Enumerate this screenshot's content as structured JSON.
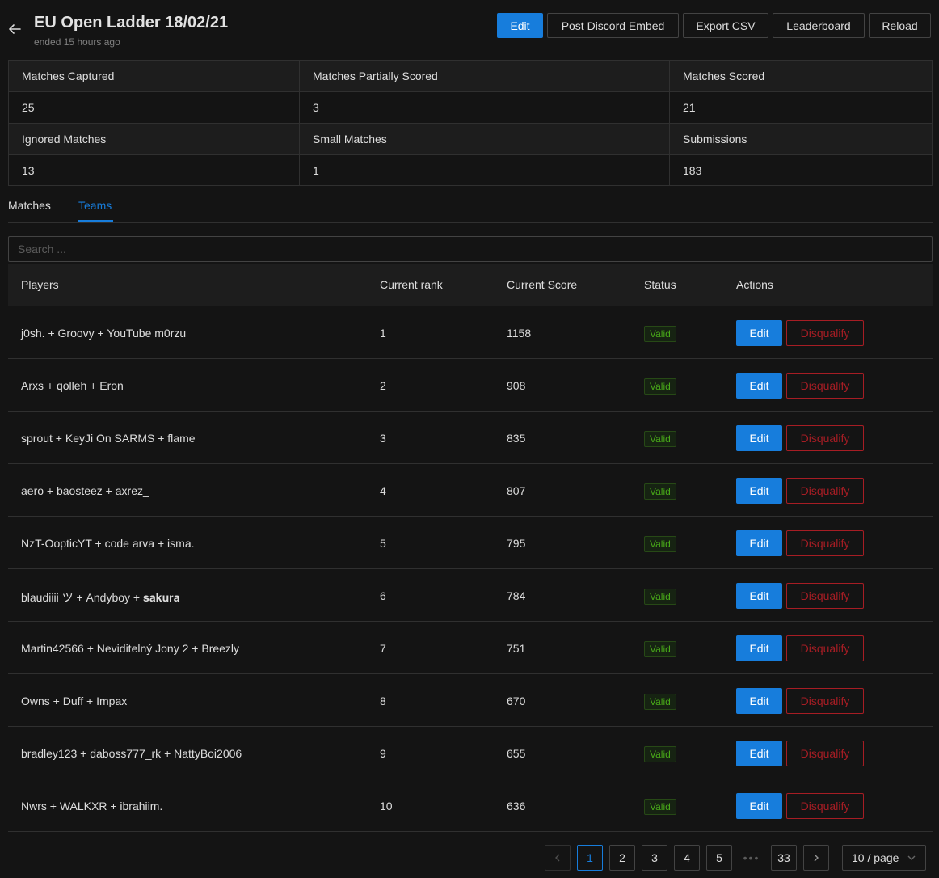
{
  "header": {
    "title": "EU Open Ladder 18/02/21",
    "subtitle": "ended 15 hours ago",
    "buttons": {
      "edit": "Edit",
      "post_discord_embed": "Post Discord Embed",
      "export_csv": "Export CSV",
      "leaderboard": "Leaderboard",
      "reload": "Reload"
    },
    "back_icon": "arrow-left-icon"
  },
  "stats": {
    "matches_captured": {
      "label": "Matches Captured",
      "value": "25"
    },
    "matches_partially_scored": {
      "label": "Matches Partially Scored",
      "value": "3"
    },
    "matches_scored": {
      "label": "Matches Scored",
      "value": "21"
    },
    "ignored_matches": {
      "label": "Ignored Matches",
      "value": "13"
    },
    "small_matches": {
      "label": "Small Matches",
      "value": "1"
    },
    "submissions": {
      "label": "Submissions",
      "value": "183"
    }
  },
  "tabs": [
    {
      "label": "Matches",
      "active": false
    },
    {
      "label": "Teams",
      "active": true
    }
  ],
  "search": {
    "placeholder": "Search ..."
  },
  "table": {
    "columns": {
      "players": "Players",
      "rank": "Current rank",
      "score": "Current Score",
      "status": "Status",
      "actions": "Actions"
    },
    "action_labels": {
      "edit": "Edit",
      "disqualify": "Disqualify"
    },
    "rows": [
      {
        "players": "j0sh. + Groovy + YouTube m0rzu",
        "rank": "1",
        "score": "1158",
        "status": "Valid"
      },
      {
        "players": "Arxs + qolleh + Eron",
        "rank": "2",
        "score": "908",
        "status": "Valid"
      },
      {
        "players": "sprout + KeyJi On SARMS + flame",
        "rank": "3",
        "score": "835",
        "status": "Valid"
      },
      {
        "players": "aero + baosteez + axrez_",
        "rank": "4",
        "score": "807",
        "status": "Valid"
      },
      {
        "players": "NzT-OopticYT + code arva + isma.",
        "rank": "5",
        "score": "795",
        "status": "Valid"
      },
      {
        "players": "blaudiiii ツ + Andyboy + 𝐬𝐚𝐤𝐮𝐫𝐚",
        "rank": "6",
        "score": "784",
        "status": "Valid"
      },
      {
        "players": "Martin42566 + Neviditelný Jony 2 + Breezly",
        "rank": "7",
        "score": "751",
        "status": "Valid"
      },
      {
        "players": "Owns + Duff + Impax",
        "rank": "8",
        "score": "670",
        "status": "Valid"
      },
      {
        "players": "bradley123 + daboss777_rk + NattyBoi2006",
        "rank": "9",
        "score": "655",
        "status": "Valid"
      },
      {
        "players": "Nwrs + WALKXR + ibrahiim.",
        "rank": "10",
        "score": "636",
        "status": "Valid"
      }
    ]
  },
  "pagination": {
    "pages": [
      "1",
      "2",
      "3",
      "4",
      "5"
    ],
    "last_page": "33",
    "current": "1",
    "ellipsis": "•••",
    "page_size": "10 / page"
  },
  "colors": {
    "primary": "#177ddc",
    "danger": "#a61d24",
    "success": "#49aa19",
    "background": "#141414"
  }
}
